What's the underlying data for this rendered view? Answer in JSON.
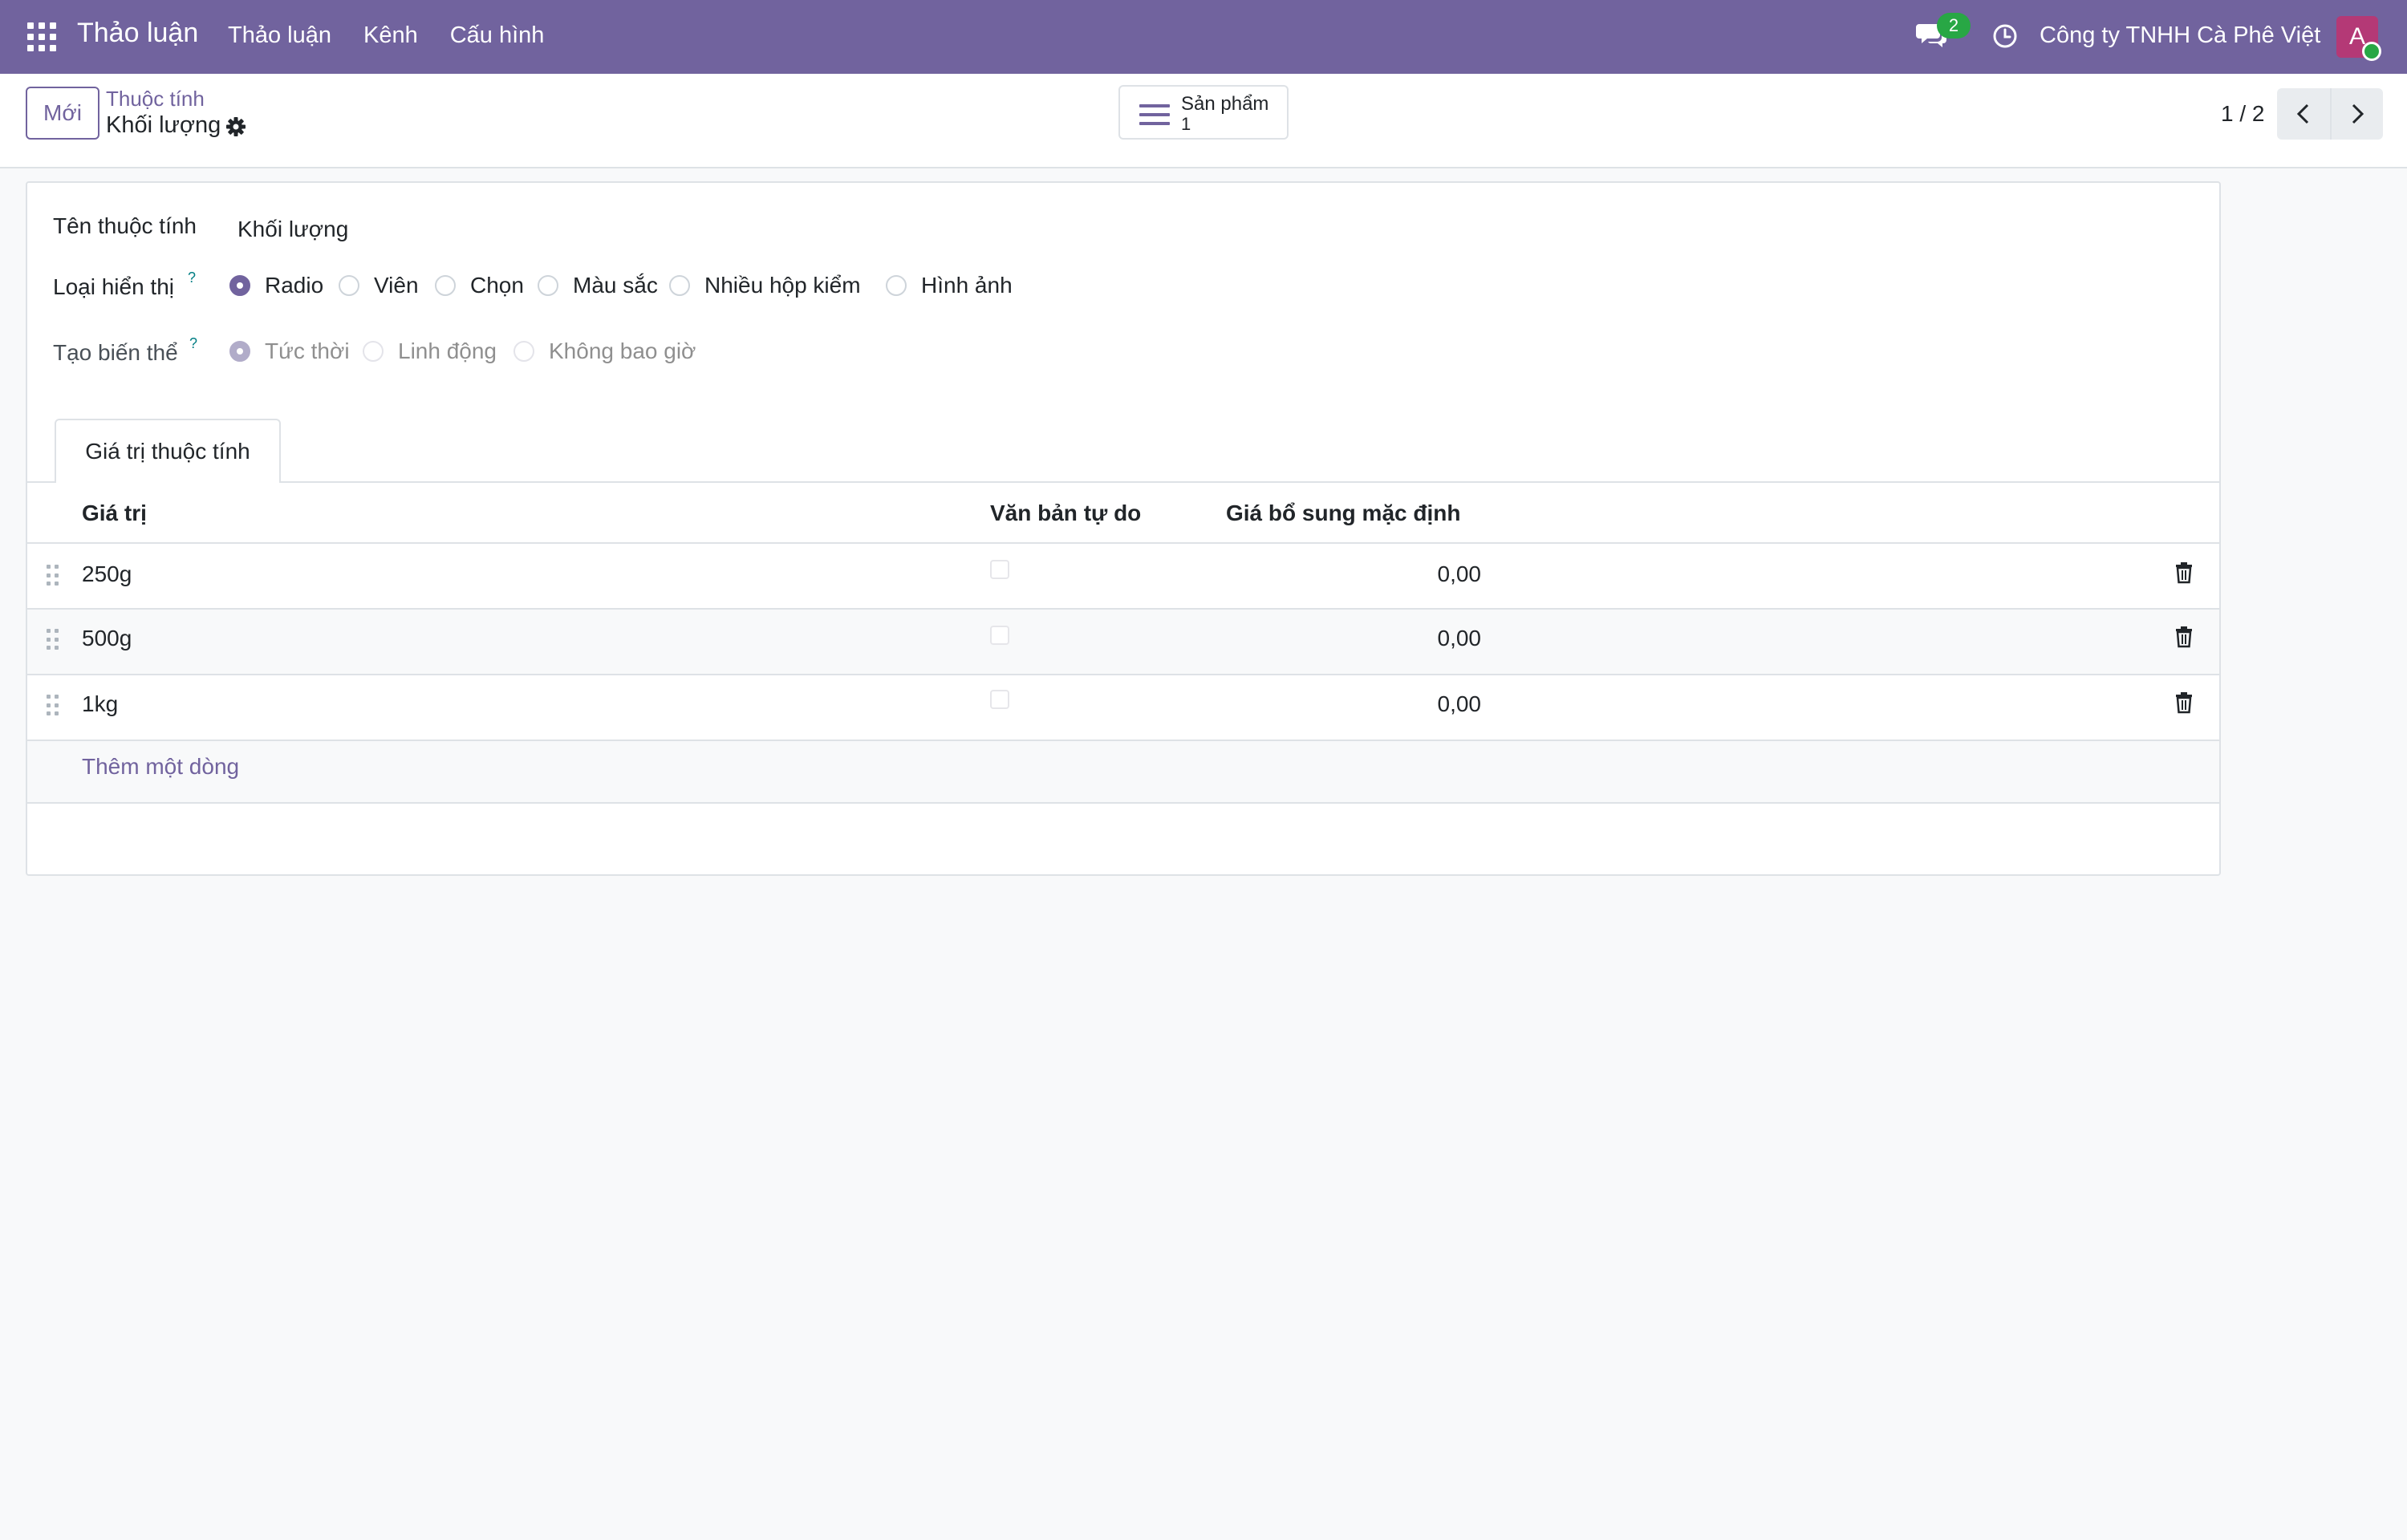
{
  "navbar": {
    "brand": "Thảo luận",
    "menu": [
      "Thảo luận",
      "Kênh",
      "Cấu hình"
    ],
    "chat_count": "2",
    "company": "Công ty TNHH Cà Phê Việt",
    "avatar_letter": "A",
    "bg_color": "#71639e"
  },
  "control": {
    "new_label": "Mới",
    "breadcrumb_parent": "Thuộc tính",
    "breadcrumb_current": "Khối lượng",
    "stat_label": "Sản phẩm",
    "stat_value": "1",
    "pager": "1 / 2"
  },
  "form": {
    "name_label": "Tên thuộc tính",
    "name_value": "Khối lượng",
    "display_label": "Loại hiển thị",
    "display_help": "?",
    "display_options": [
      "Radio",
      "Viên",
      "Chọn",
      "Màu sắc",
      "Nhiều hộp kiểm",
      "Hình ảnh"
    ],
    "display_selected": "Radio",
    "variant_label": "Tạo biến thể",
    "variant_help": "?",
    "variant_options": [
      "Tức thời",
      "Linh động",
      "Không bao giờ"
    ],
    "variant_selected": "Tức thời"
  },
  "tab": {
    "label": "Giá trị thuộc tính"
  },
  "table": {
    "headers": [
      "Giá trị",
      "Văn bản tự do",
      "Giá bổ sung mặc định"
    ],
    "rows": [
      {
        "value": "250g",
        "free_text": false,
        "extra_price": "0,00"
      },
      {
        "value": "500g",
        "free_text": false,
        "extra_price": "0,00"
      },
      {
        "value": "1kg",
        "free_text": false,
        "extra_price": "0,00"
      }
    ],
    "add_line": "Thêm một dòng"
  }
}
